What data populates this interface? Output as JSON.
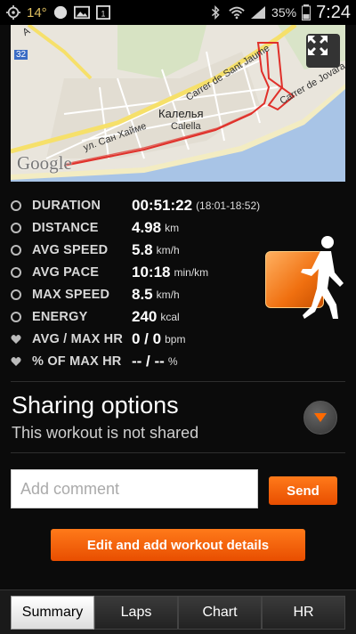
{
  "status_bar": {
    "temperature": "14°",
    "battery": "35%",
    "time": "7:24"
  },
  "map": {
    "street_1": "ул. Сан Хайме",
    "street_2": "Carrer de Sant Jaume",
    "street_3": "Carrer de Jovara",
    "city_cyrillic": "Калелья",
    "city_latin": "Calella",
    "road_badge": "32",
    "road_corner": "A",
    "google_logo": "Google"
  },
  "stats": [
    {
      "label": "DURATION",
      "value": "00:51:22",
      "unit": "(18:01-18:52)",
      "icon": "clock-icon"
    },
    {
      "label": "DISTANCE",
      "value": "4.98",
      "unit": "km",
      "icon": "distance-icon"
    },
    {
      "label": "AVG SPEED",
      "value": "5.8",
      "unit": "km/h",
      "icon": "speed-icon"
    },
    {
      "label": "AVG PACE",
      "value": "10:18",
      "unit": "min/km",
      "icon": "pace-icon"
    },
    {
      "label": "MAX SPEED",
      "value": "8.5",
      "unit": "km/h",
      "icon": "max-speed-icon"
    },
    {
      "label": "ENERGY",
      "value": "240",
      "unit": "kcal",
      "icon": "energy-icon"
    },
    {
      "label": "AVG / MAX HR",
      "value": "0 / 0",
      "unit": "bpm",
      "icon": "heart-icon"
    },
    {
      "label": "% OF MAX HR",
      "value": "-- / --",
      "unit": "%",
      "icon": "heart-icon"
    }
  ],
  "sharing": {
    "title": "Sharing options",
    "subtitle": "This workout is not shared"
  },
  "comment": {
    "placeholder": "Add comment",
    "send_label": "Send"
  },
  "edit_button": "Edit and add workout details",
  "tabs": [
    {
      "label": "Summary",
      "active": true
    },
    {
      "label": "Laps",
      "active": false
    },
    {
      "label": "Chart",
      "active": false
    },
    {
      "label": "HR",
      "active": false
    }
  ],
  "colors": {
    "accent": "#ff6a00",
    "route": "#e0302a"
  }
}
